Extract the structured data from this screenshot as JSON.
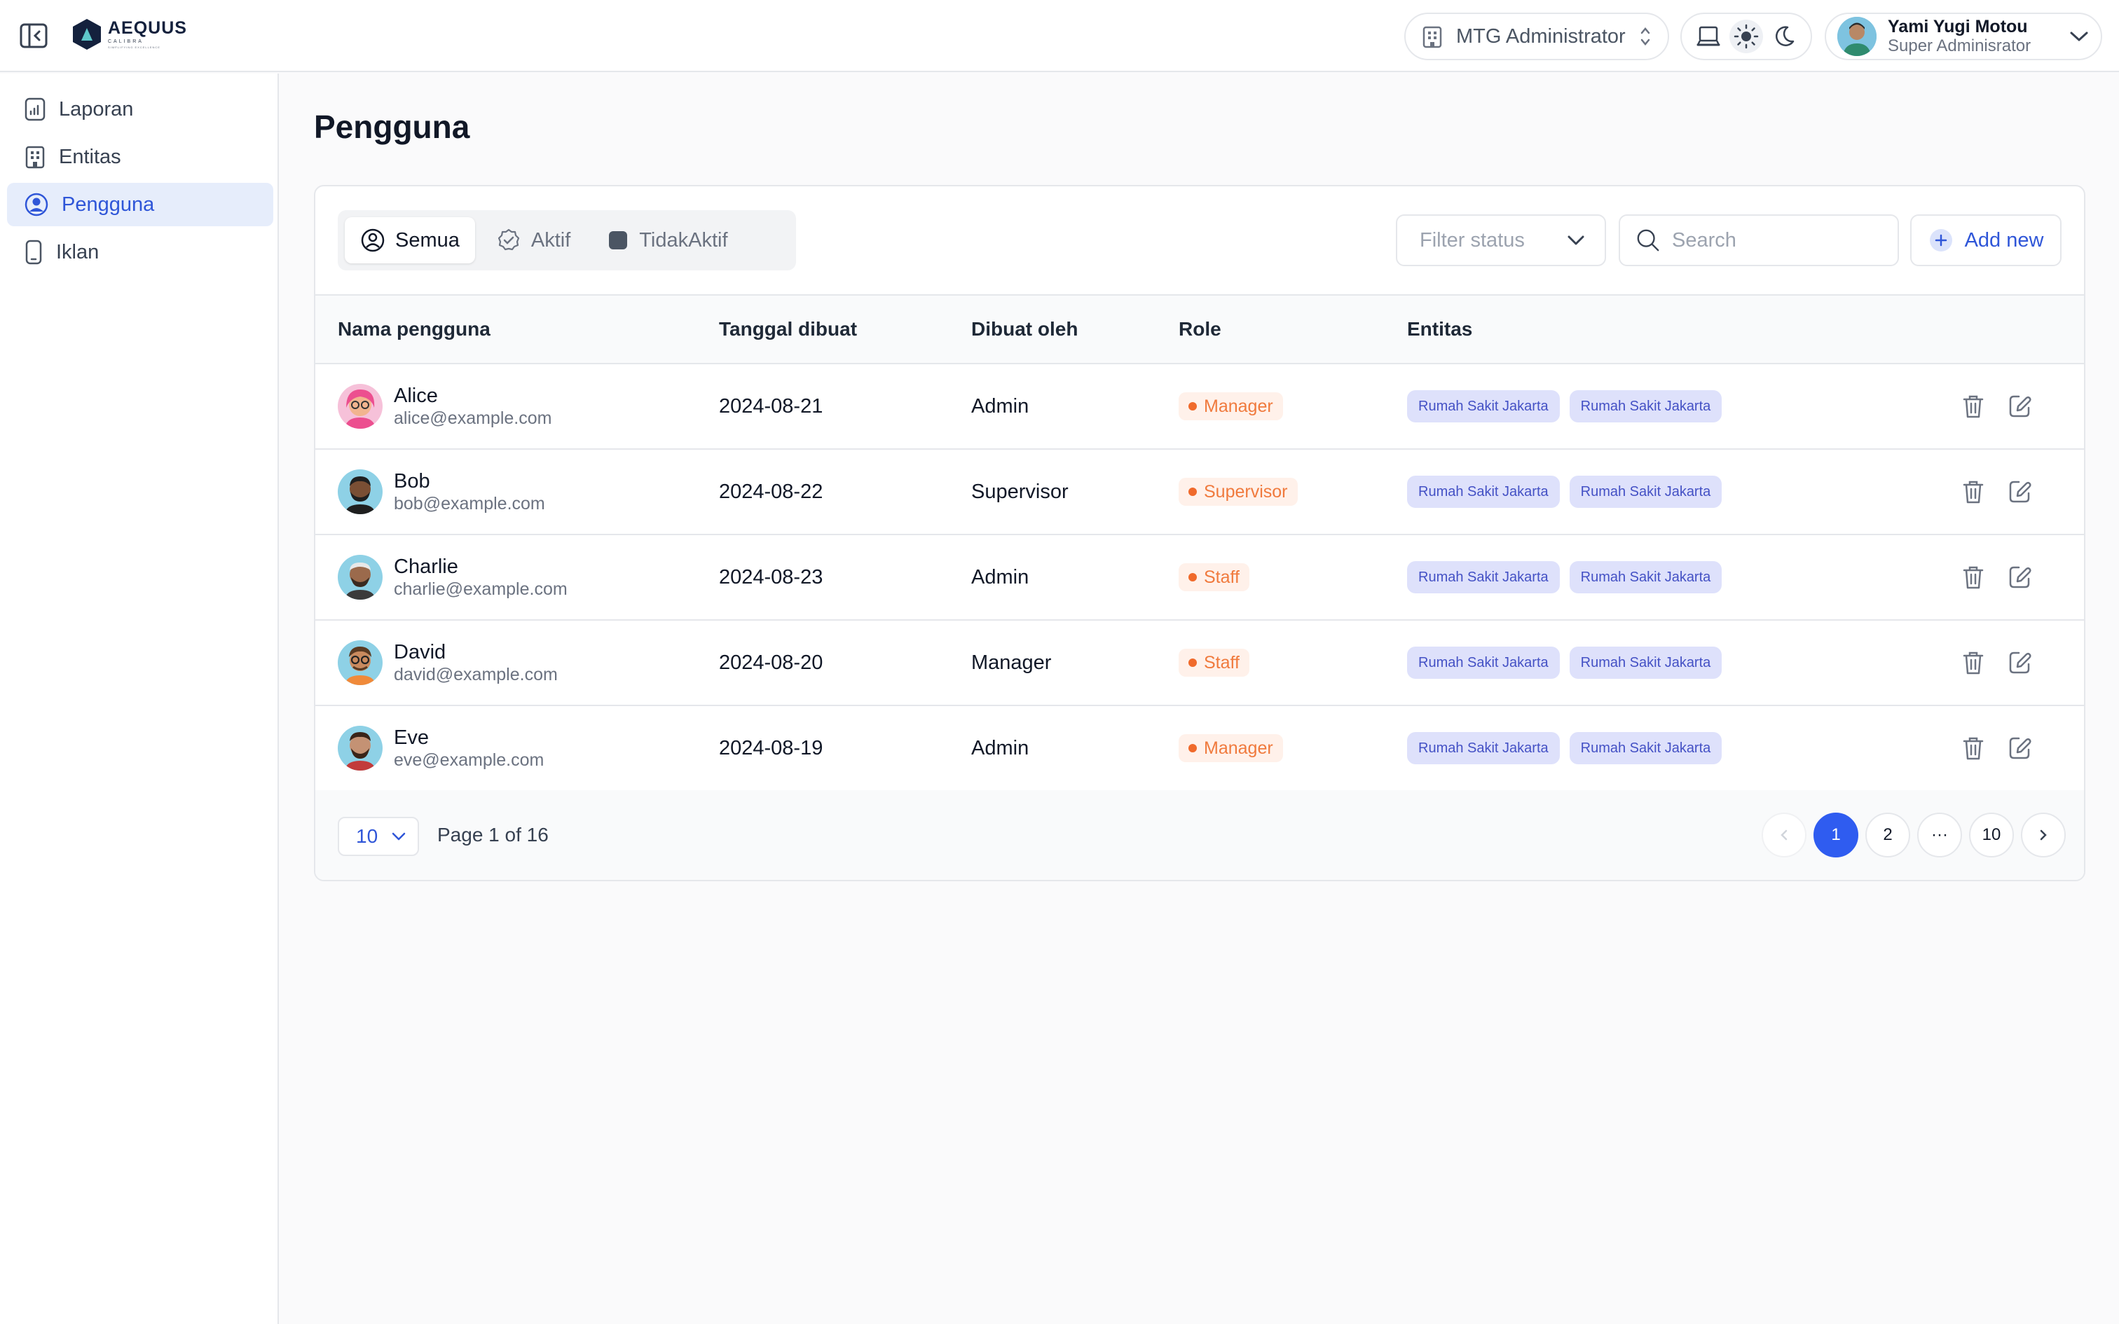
{
  "brand": {
    "name": "AEQUUS",
    "sub": "CALIBRA",
    "tagline": "SIMPLIFYING EXCELLENCE"
  },
  "header": {
    "organization": "MTG Administrator",
    "user": {
      "name": "Yami Yugi Motou",
      "role": "Super Adminisrator"
    }
  },
  "sidebar": {
    "items": [
      {
        "label": "Laporan",
        "icon": "report-icon"
      },
      {
        "label": "Entitas",
        "icon": "building-icon"
      },
      {
        "label": "Pengguna",
        "icon": "user-circle-icon",
        "active": true
      },
      {
        "label": "Iklan",
        "icon": "phone-icon"
      }
    ]
  },
  "page": {
    "title": "Pengguna"
  },
  "tabs": [
    {
      "label": "Semua",
      "icon": "user-circle-icon",
      "active": true
    },
    {
      "label": "Aktif",
      "icon": "check-badge-icon"
    },
    {
      "label": "TidakAktif",
      "icon": "square-icon"
    }
  ],
  "toolbar": {
    "filter_placeholder": "Filter status",
    "search_placeholder": "Search",
    "add_label": "Add new"
  },
  "table": {
    "headers": [
      "Nama pengguna",
      "Tanggal dibuat",
      "Dibuat oleh",
      "Role",
      "Entitas"
    ],
    "rows": [
      {
        "name": "Alice",
        "email": "alice@example.com",
        "created": "2024-08-21",
        "created_by": "Admin",
        "role": "Manager",
        "entities": [
          "Rumah Sakit Jakarta",
          "Rumah Sakit Jakarta"
        ]
      },
      {
        "name": "Bob",
        "email": "bob@example.com",
        "created": "2024-08-22",
        "created_by": "Supervisor",
        "role": "Supervisor",
        "entities": [
          "Rumah Sakit Jakarta",
          "Rumah Sakit Jakarta"
        ]
      },
      {
        "name": "Charlie",
        "email": "charlie@example.com",
        "created": "2024-08-23",
        "created_by": "Admin",
        "role": "Staff",
        "entities": [
          "Rumah Sakit Jakarta",
          "Rumah Sakit Jakarta"
        ]
      },
      {
        "name": "David",
        "email": "david@example.com",
        "created": "2024-08-20",
        "created_by": "Manager",
        "role": "Staff",
        "entities": [
          "Rumah Sakit Jakarta",
          "Rumah Sakit Jakarta"
        ]
      },
      {
        "name": "Eve",
        "email": "eve@example.com",
        "created": "2024-08-19",
        "created_by": "Admin",
        "role": "Manager",
        "entities": [
          "Rumah Sakit Jakarta",
          "Rumah Sakit Jakarta"
        ]
      }
    ]
  },
  "pagination": {
    "page_size": "10",
    "info": "Page 1 of 16",
    "pages": [
      "1",
      "2",
      "···",
      "10"
    ],
    "current": "1"
  },
  "colors": {
    "accent": "#2f56d8",
    "role_badge": "#f07a3d",
    "entity_chip": "#dee1fb"
  }
}
